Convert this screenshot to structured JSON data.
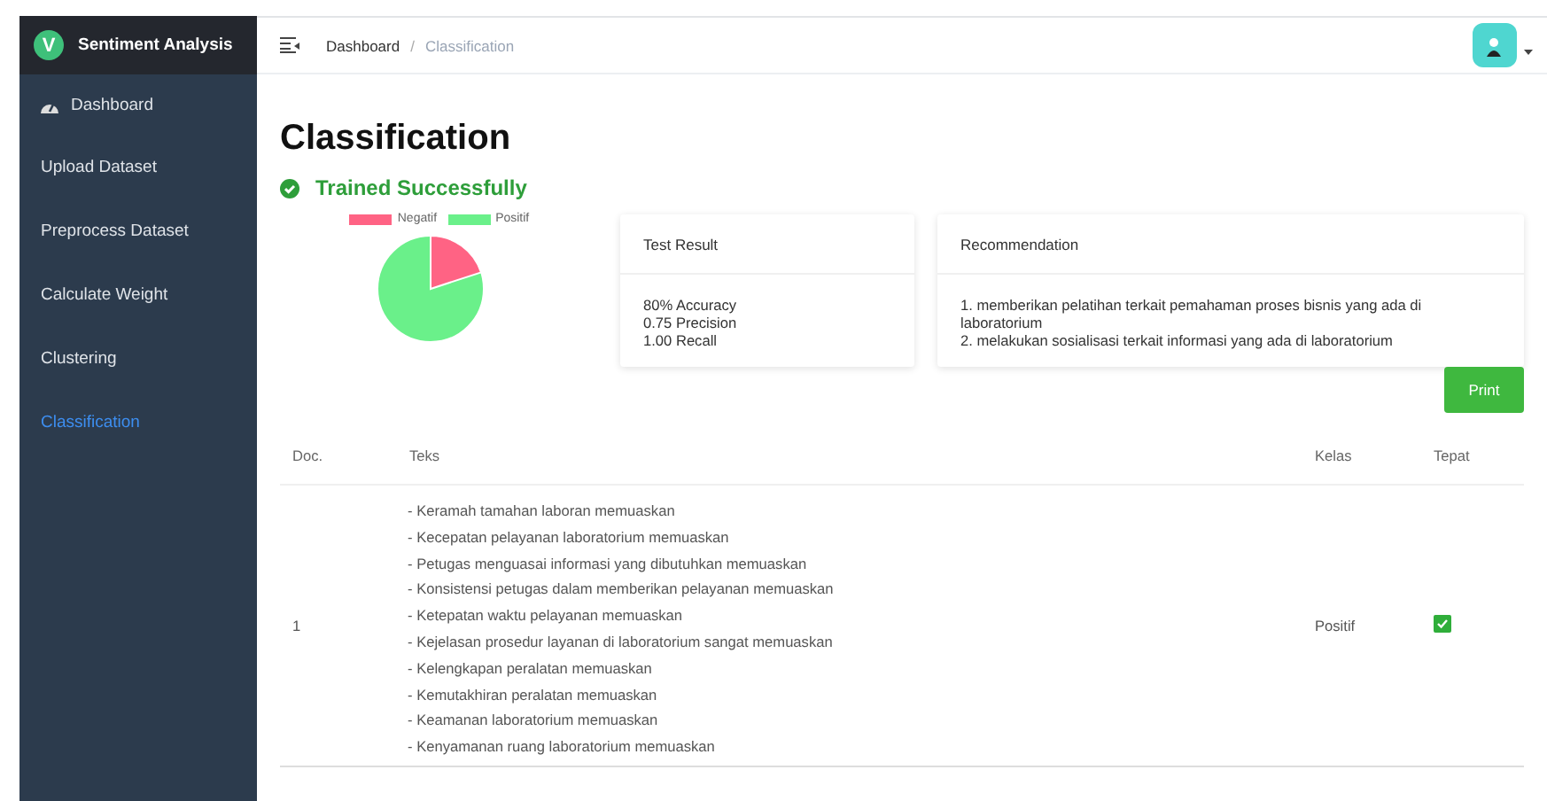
{
  "brand": {
    "logo": "V",
    "title": "Sentiment Analysis"
  },
  "sidebar": {
    "items": [
      {
        "label": "Dashboard",
        "icon": true,
        "selected": false
      },
      {
        "label": "Upload Dataset",
        "icon": false,
        "selected": false
      },
      {
        "label": "Preprocess Dataset",
        "icon": false,
        "selected": false
      },
      {
        "label": "Calculate Weight",
        "icon": false,
        "selected": false
      },
      {
        "label": "Clustering",
        "icon": false,
        "selected": false
      },
      {
        "label": "Classification",
        "icon": false,
        "selected": true
      }
    ]
  },
  "breadcrumb": [
    {
      "label": "Dashboard",
      "current": false
    },
    {
      "label": "Classification",
      "current": true
    }
  ],
  "breadcrumb_separator": "/",
  "page_title": "Classification",
  "status": {
    "text": "Trained Successfully"
  },
  "pie": {
    "legend": [
      {
        "label": "Negatif",
        "color": "#ff6384"
      },
      {
        "label": "Positif",
        "color": "#6af08a"
      }
    ]
  },
  "test_result": {
    "title": "Test Result",
    "lines": [
      "80% Accuracy",
      "0.75 Precision",
      "1.00 Recall"
    ]
  },
  "recommendation": {
    "title": "Recommendation",
    "lines": [
      "1. memberikan pelatihan terkait pemahaman proses bisnis yang ada di laboratorium",
      "2. melakukan sosialisasi terkait informasi yang ada di laboratorium"
    ]
  },
  "print_button": "Print",
  "table": {
    "columns": [
      "Doc.",
      "Teks",
      "Kelas",
      "Tepat"
    ],
    "rows": [
      {
        "doc": "1",
        "teks": [
          "- Keramah tamahan laboran memuaskan",
          "- Kecepatan pelayanan laboratorium memuaskan",
          "- Petugas menguasai informasi yang dibutuhkan memuaskan",
          "- Konsistensi petugas dalam memberikan pelayanan memuaskan",
          "- Ketepatan waktu pelayanan memuaskan",
          "- Kejelasan prosedur layanan di laboratorium sangat memuaskan",
          "- Kelengkapan peralatan memuaskan",
          "- Kemutakhiran peralatan memuaskan",
          "- Keamanan laboratorium memuaskan",
          "- Kenyamanan ruang laboratorium memuaskan"
        ],
        "kelas": "Positif",
        "tepat": true
      }
    ]
  }
}
